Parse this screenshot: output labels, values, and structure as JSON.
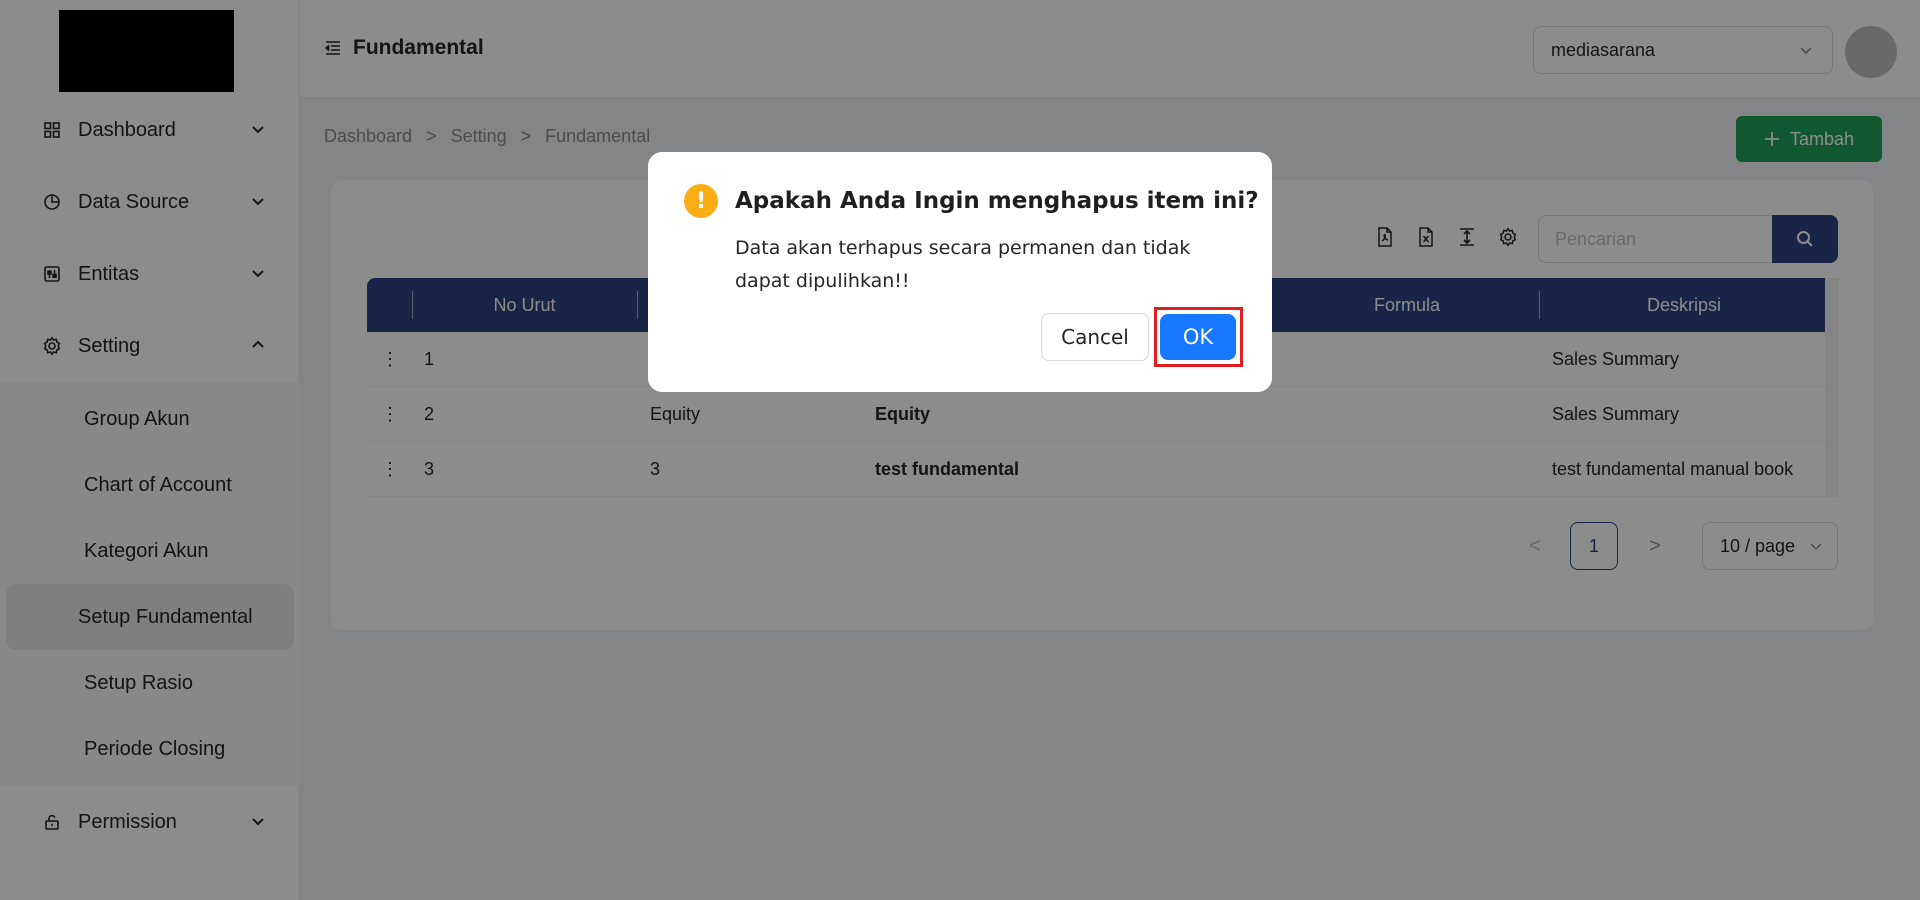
{
  "sidebar": {
    "items": [
      {
        "label": "Dashboard",
        "icon": "grid-icon",
        "expanded": false
      },
      {
        "label": "Data Source",
        "icon": "pie-chart-icon",
        "expanded": false
      },
      {
        "label": "Entitas",
        "icon": "sliders-icon",
        "expanded": false
      },
      {
        "label": "Setting",
        "icon": "gear-icon",
        "expanded": true
      },
      {
        "label": "Permission",
        "icon": "unlock-icon",
        "expanded": false
      }
    ],
    "submenu": [
      {
        "label": "Group Akun"
      },
      {
        "label": "Chart of Account"
      },
      {
        "label": "Kategori Akun"
      },
      {
        "label": "Setup Fundamental",
        "active": true
      },
      {
        "label": "Setup Rasio"
      },
      {
        "label": "Periode Closing"
      }
    ]
  },
  "header": {
    "title": "Fundamental",
    "org_select": "mediasarana"
  },
  "breadcrumb": [
    "Dashboard",
    ">",
    "Setting",
    ">",
    "Fundamental"
  ],
  "actions": {
    "add_label": "Tambah"
  },
  "search": {
    "placeholder": "Pencarian"
  },
  "table": {
    "columns": [
      "No Urut",
      "Formula",
      "Deskripsi"
    ],
    "rows": [
      {
        "no": "1",
        "code": "",
        "name": "",
        "desc": "Sales Summary"
      },
      {
        "no": "2",
        "code": "Equity",
        "name": "Equity",
        "desc": "Sales Summary"
      },
      {
        "no": "3",
        "code": "3",
        "name": "test fundamental",
        "desc": "test fundamental manual book"
      }
    ]
  },
  "pagination": {
    "prev": "<",
    "current": "1",
    "next": ">",
    "page_size": "10 / page"
  },
  "modal": {
    "icon": "!",
    "title": "Apakah Anda Ingin menghapus item ini?",
    "content": "Data akan terhapus secara permanen dan tidak dapat dipulihkan!!",
    "cancel_label": "Cancel",
    "ok_label": "OK"
  },
  "colors": {
    "primary": "#2e4482",
    "add_button": "#1fa05a",
    "ok_button": "#1677ff",
    "warning": "#faad14",
    "highlight": "#e02020"
  }
}
